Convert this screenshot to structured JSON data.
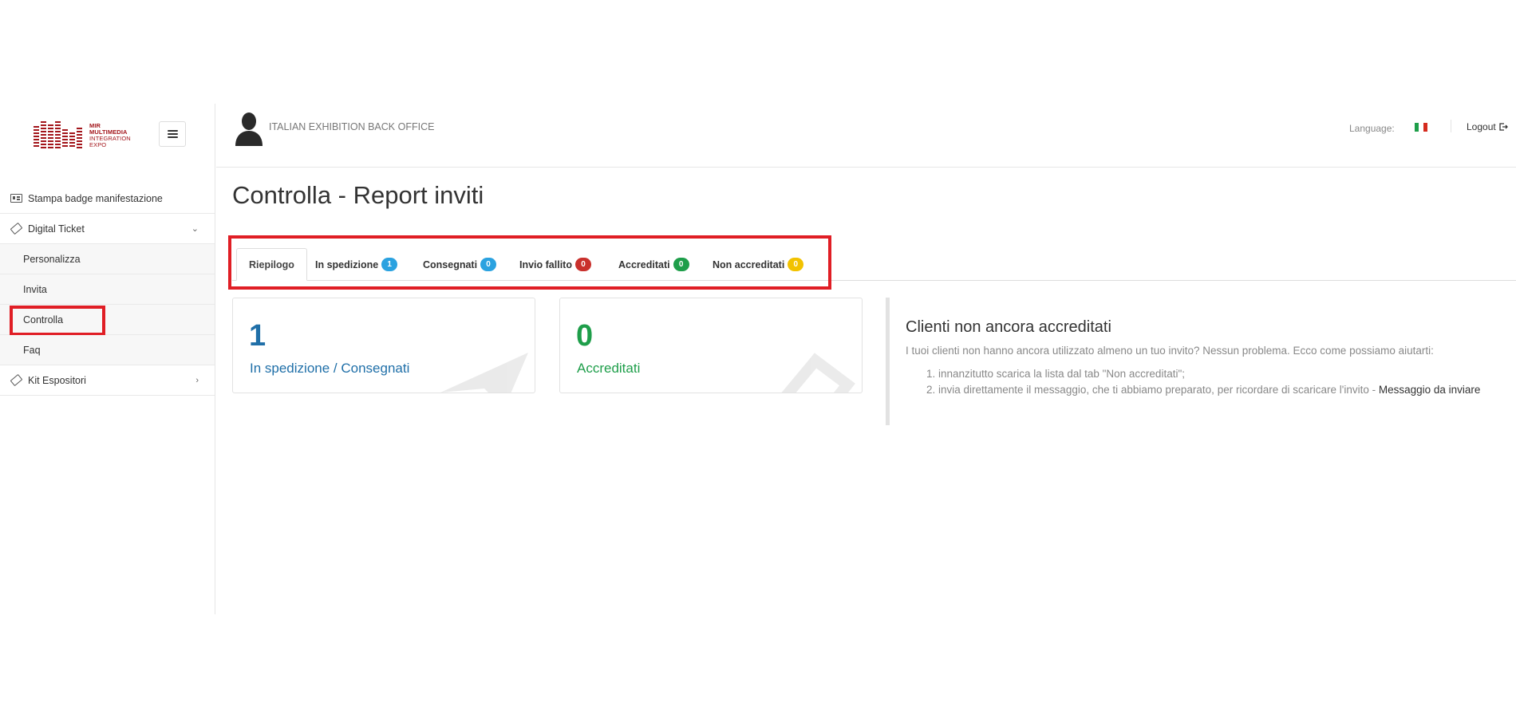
{
  "logo": {
    "line1": "MIR",
    "line2": "MULTIMEDIA",
    "line3": "INTEGRATION",
    "line4": "EXPO"
  },
  "sidebar": {
    "items": [
      {
        "label": "Stampa badge manifestazione",
        "icon": "badge-icon"
      },
      {
        "label": "Digital Ticket",
        "icon": "ticket-icon",
        "expanded": true,
        "children": [
          "Personalizza",
          "Invita",
          "Controlla",
          "Faq"
        ]
      },
      {
        "label": "Kit Espositori",
        "icon": "ticket-icon",
        "expanded": false
      }
    ],
    "active_child": "Controlla"
  },
  "header": {
    "title": "ITALIAN EXHIBITION BACK OFFICE",
    "language_label": "Language:",
    "logout_label": "Logout"
  },
  "page": {
    "title": "Controlla - Report inviti"
  },
  "tabs": [
    {
      "label": "Riepilogo",
      "active": true
    },
    {
      "label": "In spedizione",
      "count": "1",
      "color": "#2ba2e0"
    },
    {
      "label": "Consegnati",
      "count": "0",
      "color": "#2ba2e0"
    },
    {
      "label": "Invio fallito",
      "count": "0",
      "color": "#c9302c"
    },
    {
      "label": "Accreditati",
      "count": "0",
      "color": "#1e9e4a"
    },
    {
      "label": "Non accreditati",
      "count": "0",
      "color": "#f2c200"
    }
  ],
  "cards": [
    {
      "number": "1",
      "label": "In spedizione / Consegnati",
      "color": "#1f6fa8"
    },
    {
      "number": "0",
      "label": "Accreditati",
      "color": "#1e9e4a"
    }
  ],
  "callout": {
    "title": "Clienti non ancora accreditati",
    "text": "I tuoi clienti non hanno ancora utilizzato almeno un tuo invito? Nessun problema. Ecco come possiamo aiutarti:",
    "step1": "innanzitutto scarica la lista dal tab \"Non accreditati\";",
    "step2": "invia direttamente il messaggio, che ti abbiamo preparato, per ricordare di scaricare l'invito - ",
    "step2_link": "Messaggio da inviare"
  },
  "colors": {
    "highlight": "#e01e25",
    "brand": "#a3151b"
  }
}
